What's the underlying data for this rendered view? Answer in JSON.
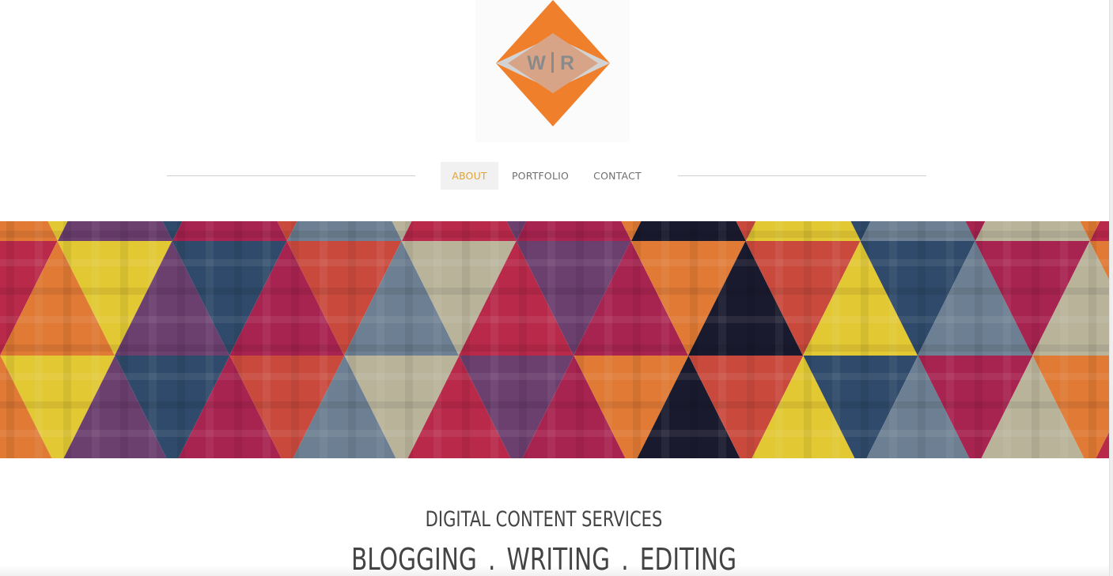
{
  "logo": {
    "text_left": "W",
    "text_right": "R",
    "colors": {
      "outer": "#ef7f2a",
      "inner": "#d8a487",
      "wing": "#d3d3d3",
      "letters": "#8a8a8a"
    }
  },
  "nav": {
    "items": [
      {
        "label": "ABOUT",
        "active": true
      },
      {
        "label": "PORTFOLIO",
        "active": false
      },
      {
        "label": "CONTACT",
        "active": false
      }
    ],
    "active_color": "#e0a33a",
    "text_color": "#6f6f6f"
  },
  "banner": {
    "pattern": "triangle-geometric",
    "palette": [
      "#1a1a2e",
      "#b8294a",
      "#e07a35",
      "#e2c833",
      "#6b3f6e",
      "#2f4a6a",
      "#a82450",
      "#c94a3d",
      "#6d7f92",
      "#b9b39a"
    ]
  },
  "content": {
    "subtitle": "DIGITAL CONTENT SERVICES",
    "services": "BLOGGING . WRITING . EDITING"
  }
}
